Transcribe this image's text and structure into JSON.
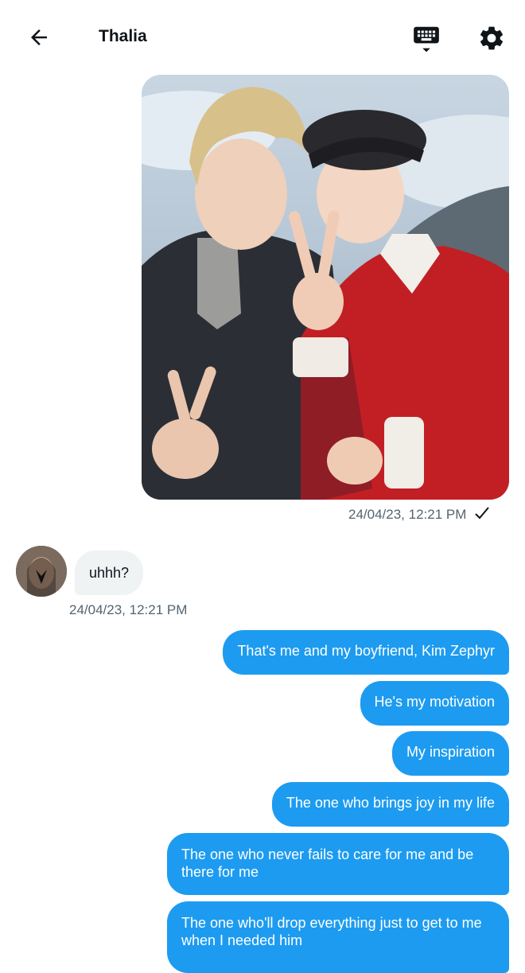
{
  "header": {
    "title": "Thalia",
    "back_icon": "arrow-left-icon",
    "keyboard_icon": "keyboard-icon",
    "settings_icon": "gear-icon"
  },
  "messages": {
    "photo": {
      "timestamp": "24/04/23, 12:21 PM",
      "status_icon": "checkmark-icon"
    },
    "received": {
      "text": "uhhh?",
      "timestamp": "24/04/23, 12:21 PM"
    },
    "sent": [
      "That's me and my boyfriend, Kim Zephyr",
      "He's my motivation",
      "My inspiration",
      "The one who brings joy in my life",
      "The one who never fails to care for me and be there for me",
      "The one who'll drop everything just to get to me when I needed him"
    ]
  },
  "colors": {
    "accent": "#1d9bf0",
    "received_bubble": "#eff3f4",
    "meta_text": "#536471"
  }
}
